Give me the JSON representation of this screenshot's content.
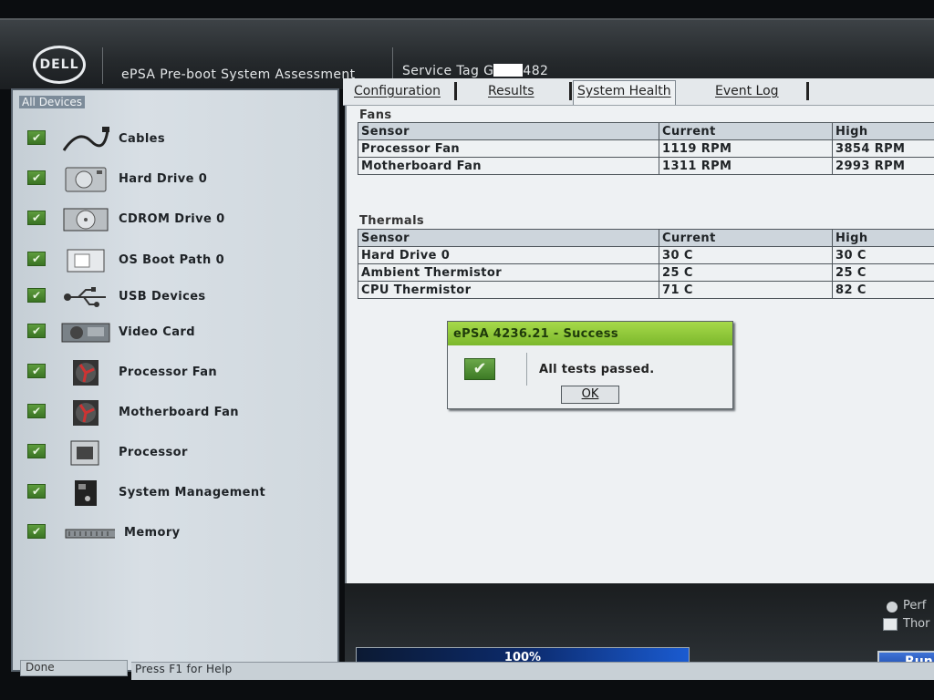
{
  "header": {
    "logo_text": "DELL",
    "title": "ePSA Pre-boot System Assessment",
    "service_tag_prefix": "Service Tag G",
    "service_tag_suffix": "482"
  },
  "left_panel": {
    "heading": "All Devices",
    "devices": [
      {
        "label": "Cables",
        "icon": "cable-icon"
      },
      {
        "label": "Hard Drive 0",
        "icon": "hard-drive-icon"
      },
      {
        "label": "CDROM Drive 0",
        "icon": "cdrom-icon"
      },
      {
        "label": "OS Boot Path 0",
        "icon": "boot-path-icon"
      },
      {
        "label": "USB Devices",
        "icon": "usb-icon"
      },
      {
        "label": "Video Card",
        "icon": "video-card-icon"
      },
      {
        "label": "Processor Fan",
        "icon": "fan-icon"
      },
      {
        "label": "Motherboard Fan",
        "icon": "fan-icon"
      },
      {
        "label": "Processor",
        "icon": "cpu-icon"
      },
      {
        "label": "System Management",
        "icon": "system-management-icon"
      },
      {
        "label": "Memory",
        "icon": "memory-icon"
      }
    ]
  },
  "tabs": [
    "Configuration",
    "Results",
    "System Health",
    "Event Log"
  ],
  "active_tab": "System Health",
  "fans": {
    "title": "Fans",
    "headers": [
      "Sensor",
      "Current",
      "High"
    ],
    "rows": [
      [
        "Processor Fan",
        "1119 RPM",
        "3854 RPM"
      ],
      [
        "Motherboard Fan",
        "1311 RPM",
        "2993 RPM"
      ]
    ]
  },
  "thermals": {
    "title": "Thermals",
    "headers": [
      "Sensor",
      "Current",
      "High"
    ],
    "rows": [
      [
        "Hard Drive 0",
        "30 C",
        "30 C"
      ],
      [
        "Ambient Thermistor",
        "25 C",
        "25 C"
      ],
      [
        "CPU Thermistor",
        "71 C",
        "82 C"
      ]
    ]
  },
  "dialog": {
    "title": "ePSA 4236.21 - Success",
    "message": "All tests passed.",
    "ok_label": "OK"
  },
  "bottom": {
    "progress_text": "100%",
    "progress_value": 100,
    "option1": "Perf",
    "option2": "Thor",
    "run_label": "Run"
  },
  "status": {
    "left": "Done",
    "help": "Press F1 for Help"
  },
  "colors": {
    "success_green": "#7cb82c",
    "check_green": "#3a7423",
    "progress_blue": "#1a5bd1"
  }
}
